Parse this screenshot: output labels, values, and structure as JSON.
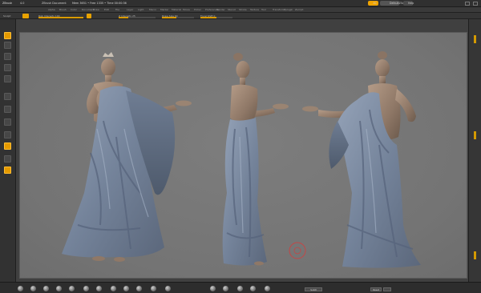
{
  "titlebar": {
    "brand": "ZBrush",
    "project": "4.0",
    "document": "ZBrush Document",
    "stats": "Mem 3651 • Free 1335 • Time 00:00:36",
    "accent_color": "#f0a400"
  },
  "menubar": {
    "items": [
      "Alpha",
      "Brush",
      "Color",
      "Document",
      "Draw",
      "Edit",
      "File",
      "Layer",
      "Light",
      "Macro",
      "Marker",
      "Material",
      "Movie",
      "Picker",
      "Preferences",
      "Render",
      "Stencil",
      "Stroke",
      "Texture",
      "Tool",
      "Transform",
      "Zplugin",
      "Zscript"
    ]
  },
  "toolbar": {
    "tool_label": "Sculpt",
    "rgb_intensity_label": "Rgb Intensity 100",
    "z_intensity_label": "Z Intensity 25",
    "draw_size_label": "Draw Size 64",
    "focal_shift_label": "Focal Shift 0",
    "rgb_intensity": 1.0,
    "z_intensity": 0.25,
    "draw_size": 0.45,
    "focal_shift": 0.5
  },
  "left_tools": [
    {
      "icon": "edit-icon",
      "active": true
    },
    {
      "icon": "draw-icon",
      "active": false
    },
    {
      "icon": "move-icon",
      "active": false
    },
    {
      "icon": "scale-icon",
      "active": false
    },
    {
      "icon": "rotate-icon",
      "active": false
    },
    {
      "icon": "brush-icon",
      "active": false
    },
    {
      "icon": "stroke-icon",
      "active": false
    },
    {
      "icon": "alpha-icon",
      "active": false
    },
    {
      "icon": "material-sphere-icon",
      "active": false
    },
    {
      "icon": "color-swatch-icon",
      "active": true
    },
    {
      "icon": "texture-icon",
      "active": false
    },
    {
      "icon": "grid-icon",
      "active": true
    }
  ],
  "bottombar": {
    "buttons": [
      "SubD",
      "Reset"
    ]
  },
  "colors": {
    "canvas": "#777777",
    "clay": "#a08a78",
    "drape": "#7d8aa0"
  }
}
